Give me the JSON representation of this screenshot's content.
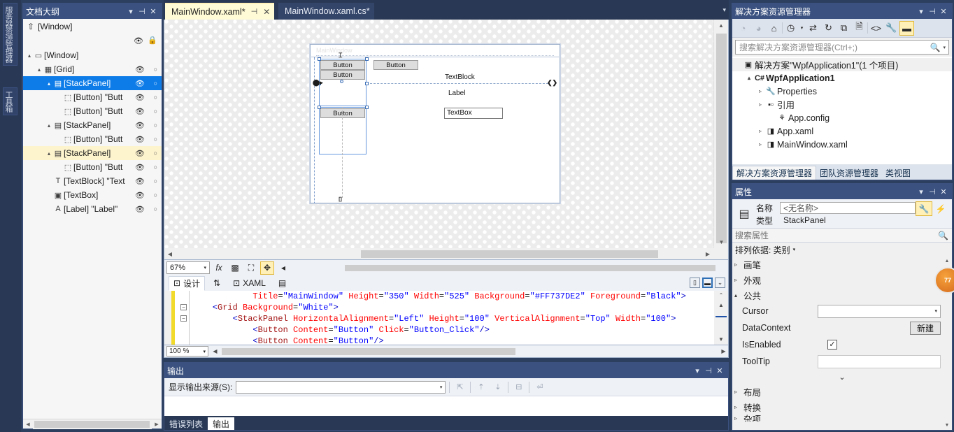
{
  "vertical_tabs": [
    "服务器资源管理器",
    "工具箱"
  ],
  "document_outline": {
    "title": "文档大纲",
    "window_root": "[Window]",
    "buttons": {
      "dropdown": "▾",
      "pin": "⊣",
      "close": "✕"
    },
    "root_eye_icon": "eye-icon",
    "root_lock_icon": "lock-icon",
    "tree": [
      {
        "indent": 0,
        "twisty": "▴",
        "icon": "▭",
        "label": "[Window]",
        "eye": "",
        "dot": "",
        "state": "normal"
      },
      {
        "indent": 1,
        "twisty": "▴",
        "icon": "▦",
        "label": "[Grid]",
        "eye": "👁",
        "dot": "○",
        "state": "normal"
      },
      {
        "indent": 2,
        "twisty": "▴",
        "icon": "▤",
        "label": "[StackPanel]",
        "eye": "👁",
        "dot": "○",
        "state": "selected"
      },
      {
        "indent": 3,
        "twisty": "",
        "icon": "⬚",
        "label": "[Button] \"Butt",
        "eye": "👁",
        "dot": "○",
        "state": "normal"
      },
      {
        "indent": 3,
        "twisty": "",
        "icon": "⬚",
        "label": "[Button] \"Butt",
        "eye": "👁",
        "dot": "○",
        "state": "normal"
      },
      {
        "indent": 2,
        "twisty": "▴",
        "icon": "▤",
        "label": "[StackPanel]",
        "eye": "👁",
        "dot": "○",
        "state": "normal"
      },
      {
        "indent": 3,
        "twisty": "",
        "icon": "⬚",
        "label": "[Button] \"Butt",
        "eye": "👁",
        "dot": "○",
        "state": "normal"
      },
      {
        "indent": 2,
        "twisty": "▴",
        "icon": "▤",
        "label": "[StackPanel]",
        "eye": "👁",
        "dot": "○",
        "state": "highlight"
      },
      {
        "indent": 3,
        "twisty": "",
        "icon": "⬚",
        "label": "[Button] \"Butt",
        "eye": "👁",
        "dot": "○",
        "state": "normal"
      },
      {
        "indent": 2,
        "twisty": "",
        "icon": "T",
        "label": "[TextBlock] \"Text",
        "eye": "👁",
        "dot": "○",
        "state": "normal"
      },
      {
        "indent": 2,
        "twisty": "",
        "icon": "▣",
        "label": "[TextBox]",
        "eye": "👁",
        "dot": "○",
        "state": "normal"
      },
      {
        "indent": 2,
        "twisty": "",
        "icon": "A",
        "label": "[Label] \"Label\"",
        "eye": "👁",
        "dot": "○",
        "state": "normal"
      }
    ]
  },
  "editor_tabs": [
    {
      "label": "MainWindow.xaml*",
      "active": true,
      "pin": "⊣",
      "close": "✕"
    },
    {
      "label": "MainWindow.xaml.cs*",
      "active": false
    }
  ],
  "designer": {
    "window_title": "MainWindow",
    "preview_controls": [
      {
        "type": "button",
        "label": "Button"
      },
      {
        "type": "button",
        "label": "Button"
      },
      {
        "type": "button",
        "label": "Button"
      },
      {
        "type": "button",
        "label": "Button"
      },
      {
        "type": "textblock",
        "label": "TextBlock"
      },
      {
        "type": "label",
        "label": "Label"
      },
      {
        "type": "textbox",
        "label": "TextBox"
      }
    ],
    "toolbar": {
      "zoom": "67%",
      "icons": [
        "fx-icon",
        "grid-icon",
        "snap-icon",
        "move-icon",
        "collapse-arrow-icon"
      ]
    }
  },
  "split_bar": {
    "design_label": "设计",
    "swap_icon": "⇅",
    "xaml_label": "XAML",
    "doc_icon": "▤",
    "right_buttons": [
      "split-vertical-icon",
      "split-horizontal-icon",
      "collapse-pane-icon"
    ]
  },
  "code": {
    "zoom": "100 %",
    "lines": [
      [
        {
          "t": "            ",
          "c": "plain"
        },
        {
          "t": "Title",
          "c": "attr"
        },
        {
          "t": "=",
          "c": "plain"
        },
        {
          "t": "\"MainWindow\"",
          "c": "val"
        },
        {
          "t": " ",
          "c": "plain"
        },
        {
          "t": "Height",
          "c": "attr"
        },
        {
          "t": "=",
          "c": "plain"
        },
        {
          "t": "\"350\"",
          "c": "val"
        },
        {
          "t": " ",
          "c": "plain"
        },
        {
          "t": "Width",
          "c": "attr"
        },
        {
          "t": "=",
          "c": "plain"
        },
        {
          "t": "\"525\"",
          "c": "val"
        },
        {
          "t": " ",
          "c": "plain"
        },
        {
          "t": "Background",
          "c": "attr"
        },
        {
          "t": "=",
          "c": "plain"
        },
        {
          "t": "\"#FF737DE2\"",
          "c": "val"
        },
        {
          "t": " ",
          "c": "plain"
        },
        {
          "t": "Foreground",
          "c": "attr"
        },
        {
          "t": "=",
          "c": "plain"
        },
        {
          "t": "\"Black\"",
          "c": "val"
        },
        {
          "t": ">",
          "c": "tag"
        }
      ],
      [
        {
          "t": "    ",
          "c": "plain"
        },
        {
          "t": "<",
          "c": "tag"
        },
        {
          "t": "Grid",
          "c": "el"
        },
        {
          "t": " ",
          "c": "plain"
        },
        {
          "t": "Background",
          "c": "attr"
        },
        {
          "t": "=",
          "c": "plain"
        },
        {
          "t": "\"White\"",
          "c": "val"
        },
        {
          "t": ">",
          "c": "tag"
        }
      ],
      [
        {
          "t": "        ",
          "c": "plain"
        },
        {
          "t": "<",
          "c": "tag"
        },
        {
          "t": "StackPanel",
          "c": "el"
        },
        {
          "t": " ",
          "c": "plain"
        },
        {
          "t": "HorizontalAlignment",
          "c": "attr"
        },
        {
          "t": "=",
          "c": "plain"
        },
        {
          "t": "\"Left\"",
          "c": "val"
        },
        {
          "t": " ",
          "c": "plain"
        },
        {
          "t": "Height",
          "c": "attr"
        },
        {
          "t": "=",
          "c": "plain"
        },
        {
          "t": "\"100\"",
          "c": "val"
        },
        {
          "t": " ",
          "c": "plain"
        },
        {
          "t": "VerticalAlignment",
          "c": "attr"
        },
        {
          "t": "=",
          "c": "plain"
        },
        {
          "t": "\"Top\"",
          "c": "val"
        },
        {
          "t": " ",
          "c": "plain"
        },
        {
          "t": "Width",
          "c": "attr"
        },
        {
          "t": "=",
          "c": "plain"
        },
        {
          "t": "\"100\"",
          "c": "val"
        },
        {
          "t": ">",
          "c": "tag"
        }
      ],
      [
        {
          "t": "            ",
          "c": "plain"
        },
        {
          "t": "<",
          "c": "tag"
        },
        {
          "t": "Button",
          "c": "el"
        },
        {
          "t": " ",
          "c": "plain"
        },
        {
          "t": "Content",
          "c": "attr"
        },
        {
          "t": "=",
          "c": "plain"
        },
        {
          "t": "\"Button\"",
          "c": "val"
        },
        {
          "t": " ",
          "c": "plain"
        },
        {
          "t": "Click",
          "c": "attr"
        },
        {
          "t": "=",
          "c": "plain"
        },
        {
          "t": "\"Button_Click\"",
          "c": "val"
        },
        {
          "t": "/>",
          "c": "tag"
        }
      ],
      [
        {
          "t": "            ",
          "c": "plain"
        },
        {
          "t": "<",
          "c": "tag"
        },
        {
          "t": "Button",
          "c": "el"
        },
        {
          "t": " ",
          "c": "plain"
        },
        {
          "t": "Content",
          "c": "attr"
        },
        {
          "t": "=",
          "c": "plain"
        },
        {
          "t": "\"Button\"",
          "c": "val"
        },
        {
          "t": "/>",
          "c": "tag"
        }
      ]
    ]
  },
  "output": {
    "title": "输出",
    "source_label": "显示输出来源(S):",
    "source_value": "",
    "icons": [
      "find-message-icon",
      "goto-prev-icon",
      "goto-next-icon",
      "clear-all-icon",
      "word-wrap-icon"
    ],
    "tabs": [
      {
        "label": "错误列表",
        "active": false
      },
      {
        "label": "输出",
        "active": true
      }
    ],
    "buttons": {
      "dropdown": "▾",
      "pin": "⊣",
      "close": "✕"
    }
  },
  "solution_explorer": {
    "title": "解决方案资源管理器",
    "buttons": {
      "dropdown": "▾",
      "pin": "⊣",
      "close": "✕"
    },
    "toolbar_icons": [
      "back-icon",
      "forward-icon",
      "home-icon",
      "pending-changes-icon",
      "sync-icon",
      "refresh-icon",
      "collapse-all-icon",
      "show-all-files-icon",
      "view-code-icon",
      "properties-icon",
      "preview-selected-icon"
    ],
    "search_placeholder": "搜索解决方案资源管理器(Ctrl+;)",
    "tree": [
      {
        "indent": 0,
        "twisty": "",
        "icon": "solution-icon",
        "glyph": "▣",
        "label": "解决方案\"WpfApplication1\"(1 个项目)",
        "bold": false,
        "node": true
      },
      {
        "indent": 1,
        "twisty": "▴",
        "icon": "csharp-project-icon",
        "glyph": "C#",
        "label": "WpfApplication1",
        "bold": true,
        "node": false
      },
      {
        "indent": 2,
        "twisty": "▹",
        "icon": "properties-icon",
        "glyph": "🔧",
        "label": "Properties",
        "bold": false,
        "node": false
      },
      {
        "indent": 2,
        "twisty": "▹",
        "icon": "references-icon",
        "glyph": "▪▫",
        "label": "引用",
        "bold": false,
        "node": false
      },
      {
        "indent": 3,
        "twisty": "",
        "icon": "config-file-icon",
        "glyph": "⚘",
        "label": "App.config",
        "bold": false,
        "node": false
      },
      {
        "indent": 2,
        "twisty": "▹",
        "icon": "xaml-file-icon",
        "glyph": "◨",
        "label": "App.xaml",
        "bold": false,
        "node": false
      },
      {
        "indent": 2,
        "twisty": "▹",
        "icon": "xaml-file-icon",
        "glyph": "◨",
        "label": "MainWindow.xaml",
        "bold": false,
        "node": false
      }
    ],
    "tabs": [
      {
        "label": "解决方案资源管理器",
        "active": true
      },
      {
        "label": "团队资源管理器",
        "active": false
      },
      {
        "label": "类视图",
        "active": false
      }
    ]
  },
  "properties": {
    "title": "属性",
    "buttons": {
      "dropdown": "▾",
      "pin": "⊣",
      "close": "✕"
    },
    "type_icon": "stackpanel-icon",
    "name_label": "名称",
    "name_value": "<无名称>",
    "type_label": "类型",
    "type_value": "StackPanel",
    "tool_buttons": [
      "wrench-properties-icon",
      "lightning-events-icon"
    ],
    "search_placeholder": "搜索属性",
    "sort_label": "排列依据: 类别",
    "categories": [
      {
        "label": "画笔",
        "expanded": false
      },
      {
        "label": "外观",
        "expanded": false
      },
      {
        "label": "公共",
        "expanded": true
      },
      {
        "label": "布局",
        "expanded": false
      },
      {
        "label": "转换",
        "expanded": false
      },
      {
        "label": "杂项",
        "expanded": false
      }
    ],
    "common_props": [
      {
        "name": "Cursor",
        "kind": "combo",
        "value": ""
      },
      {
        "name": "DataContext",
        "kind": "button",
        "value": "新建"
      },
      {
        "name": "IsEnabled",
        "kind": "checkbox",
        "value": "✓"
      },
      {
        "name": "ToolTip",
        "kind": "text",
        "value": ""
      }
    ],
    "more_chevron": "⌄"
  },
  "badge": {
    "text": "77"
  }
}
